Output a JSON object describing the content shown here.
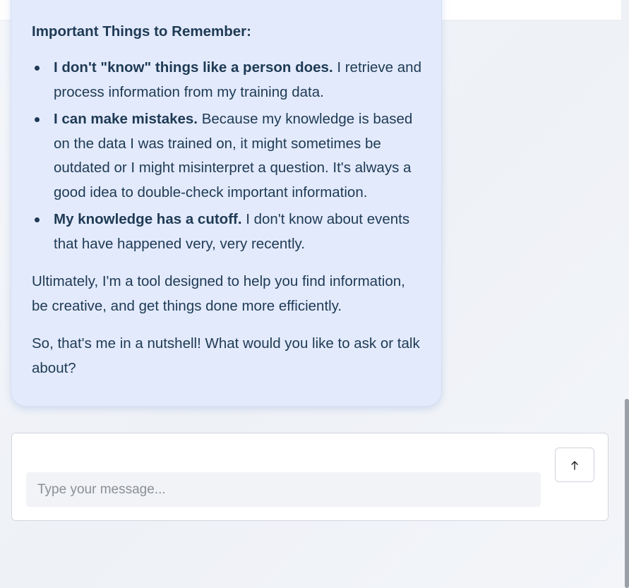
{
  "message": {
    "heading": "Important Things to Remember:",
    "points": [
      {
        "bold": "I don't \"know\" things like a person does.",
        "text": " I retrieve and process information from my training data."
      },
      {
        "bold": "I can make mistakes.",
        "text": " Because my knowledge is based on the data I was trained on, it might sometimes be outdated or I might misinterpret a question. It's always a good idea to double-check important information."
      },
      {
        "bold": "My knowledge has a cutoff.",
        "text": " I don't know about events that have happened very, very recently."
      }
    ],
    "paragraph_1": "Ultimately, I'm a tool designed to help you find information, be creative, and get things done more efficiently.",
    "paragraph_2": "So, that's me in a nutshell! What would you like to ask or talk about?"
  },
  "composer": {
    "input_value": "",
    "placeholder": "Type your message...",
    "send_icon": "arrow-up-icon"
  },
  "colors": {
    "bubble_background": "#e3eafb",
    "text": "#1e3a55",
    "input_background": "#f1f3f6",
    "scrollbar_thumb": "#9aa0a6"
  }
}
